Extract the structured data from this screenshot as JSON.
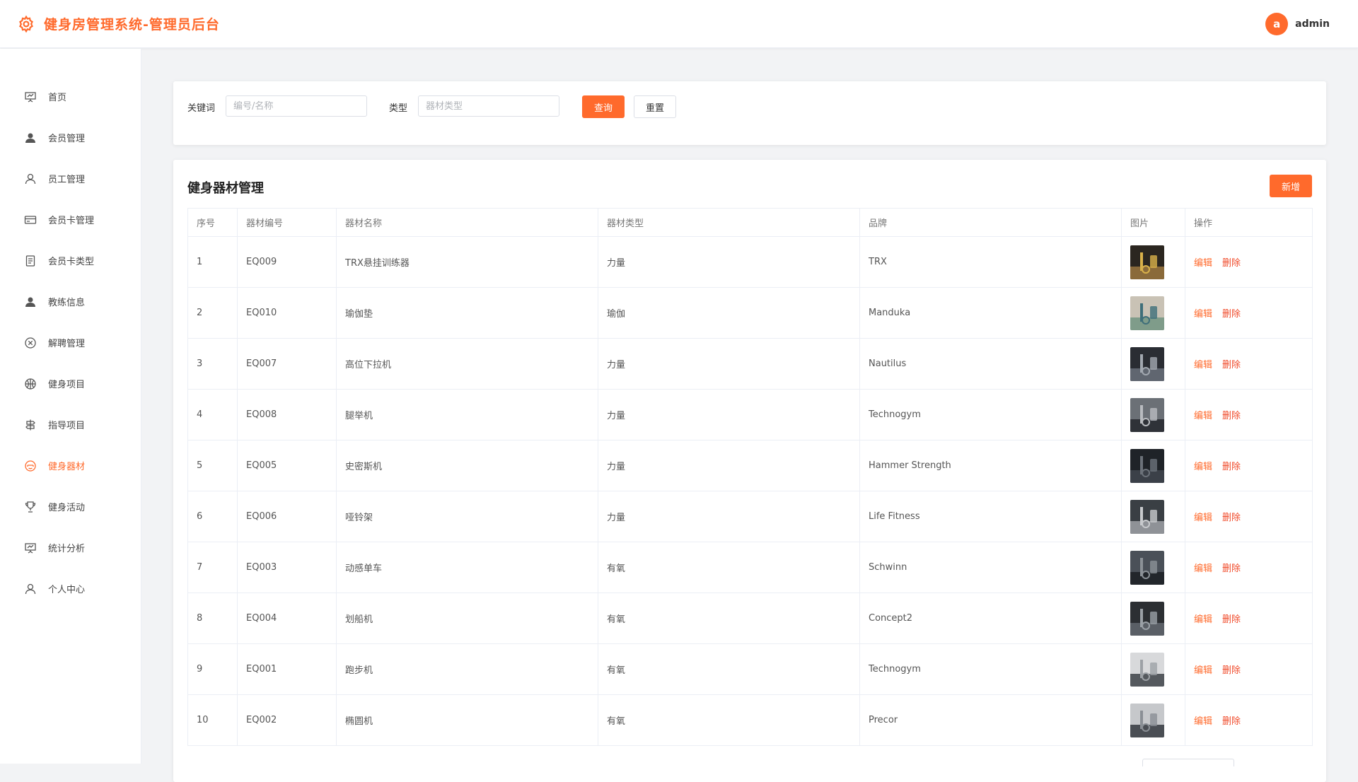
{
  "header": {
    "title": "健身房管理系统-管理员后台",
    "avatar_letter": "a",
    "username": "admin",
    "logo_icon": "gear-icon"
  },
  "sidebar": {
    "items": [
      {
        "label": "首页",
        "icon": "presentation-icon",
        "active": false
      },
      {
        "label": "会员管理",
        "icon": "user-solid-icon",
        "active": false
      },
      {
        "label": "员工管理",
        "icon": "user-outline-icon",
        "active": false
      },
      {
        "label": "会员卡管理",
        "icon": "card-icon",
        "active": false
      },
      {
        "label": "会员卡类型",
        "icon": "document-icon",
        "active": false
      },
      {
        "label": "教练信息",
        "icon": "user-solid-icon",
        "active": false
      },
      {
        "label": "解聘管理",
        "icon": "circle-close-icon",
        "active": false
      },
      {
        "label": "健身项目",
        "icon": "basketball-icon",
        "active": false
      },
      {
        "label": "指导项目",
        "icon": "guide-icon",
        "active": false
      },
      {
        "label": "健身器材",
        "icon": "equipment-icon",
        "active": true
      },
      {
        "label": "健身活动",
        "icon": "trophy-icon",
        "active": false
      },
      {
        "label": "统计分析",
        "icon": "chart-board-icon",
        "active": false
      },
      {
        "label": "个人中心",
        "icon": "user-outline-icon",
        "active": false
      }
    ]
  },
  "filter": {
    "keyword_label": "关键词",
    "keyword_placeholder": "编号/名称",
    "keyword_value": "",
    "type_label": "类型",
    "type_placeholder": "器材类型",
    "type_value": "",
    "search_label": "查询",
    "reset_label": "重置"
  },
  "table_card": {
    "title": "健身器材管理",
    "add_label": "新增",
    "columns": [
      "序号",
      "器材编号",
      "器材名称",
      "器材类型",
      "品牌",
      "图片",
      "操作"
    ],
    "edit_label": "编辑",
    "delete_label": "删除",
    "rows": [
      {
        "no": "1",
        "code": "EQ009",
        "name": "TRX悬挂训练器",
        "type": "力量",
        "brand": "TRX"
      },
      {
        "no": "2",
        "code": "EQ010",
        "name": "瑜伽垫",
        "type": "瑜伽",
        "brand": "Manduka"
      },
      {
        "no": "3",
        "code": "EQ007",
        "name": "高位下拉机",
        "type": "力量",
        "brand": "Nautilus"
      },
      {
        "no": "4",
        "code": "EQ008",
        "name": "腿举机",
        "type": "力量",
        "brand": "Technogym"
      },
      {
        "no": "5",
        "code": "EQ005",
        "name": "史密斯机",
        "type": "力量",
        "brand": "Hammer Strength"
      },
      {
        "no": "6",
        "code": "EQ006",
        "name": "哑铃架",
        "type": "力量",
        "brand": "Life Fitness"
      },
      {
        "no": "7",
        "code": "EQ003",
        "name": "动感单车",
        "type": "有氧",
        "brand": "Schwinn"
      },
      {
        "no": "8",
        "code": "EQ004",
        "name": "划船机",
        "type": "有氧",
        "brand": "Concept2"
      },
      {
        "no": "9",
        "code": "EQ001",
        "name": "跑步机",
        "type": "有氧",
        "brand": "Technogym"
      },
      {
        "no": "10",
        "code": "EQ002",
        "name": "椭圆机",
        "type": "有氧",
        "brand": "Precor"
      }
    ]
  },
  "colors": {
    "accent": "#ff6a2c",
    "danger": "#f04a2a"
  }
}
